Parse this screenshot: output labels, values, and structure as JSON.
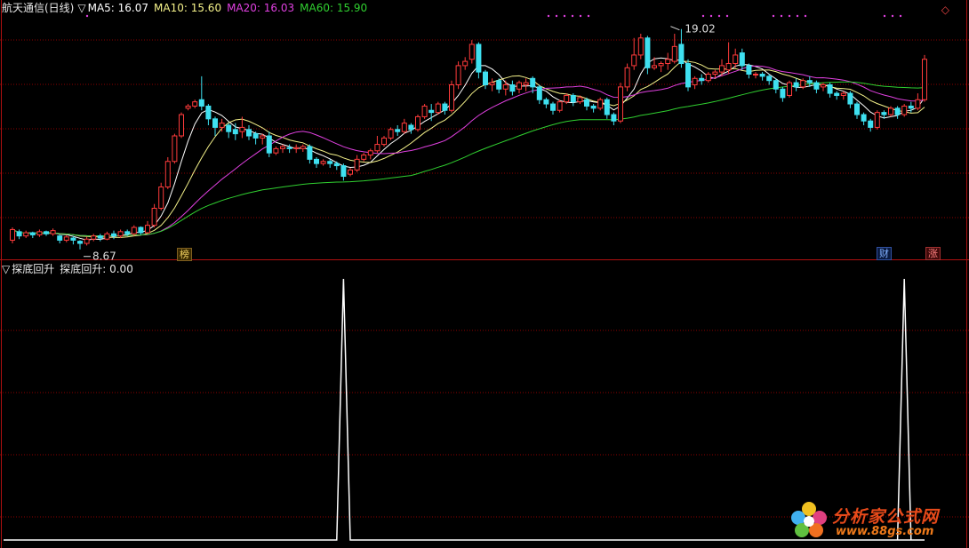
{
  "header": {
    "stock_name": "航天通信(日线)",
    "toggle": "▽",
    "ma5": "MA5: 16.07",
    "ma10": "MA10: 15.60",
    "ma20": "MA20: 16.03",
    "ma60": "MA60: 15.90"
  },
  "sub_header": {
    "toggle": "▽",
    "indicator": "探底回升",
    "value": "探底回升: 0.00"
  },
  "price_annotations": {
    "high": "19.02",
    "low": "8.67"
  },
  "badges": {
    "bang": "榜",
    "cai": "财",
    "zhang": "涨"
  },
  "logo": {
    "name": "分析家公式网",
    "url": "www.88gs.com"
  },
  "colors": {
    "up": "#ff3b3b",
    "down": "#3fe0f0",
    "ma5": "#ffffff",
    "ma10": "#f5f28a",
    "ma20": "#e040e0",
    "ma60": "#30d030",
    "grid": "#8b0000",
    "indicator": "#ffffff"
  },
  "chart_data": [
    {
      "type": "candlestick",
      "title": "航天通信(日线)",
      "ylim": [
        8.2,
        19.8
      ],
      "candles": [
        [
          9.1,
          9.6,
          8.95,
          9.7
        ],
        [
          9.5,
          9.3,
          9.15,
          9.6
        ],
        [
          9.3,
          9.45,
          9.2,
          9.55
        ],
        [
          9.45,
          9.35,
          9.2,
          9.5
        ],
        [
          9.35,
          9.5,
          9.25,
          9.6
        ],
        [
          9.5,
          9.4,
          9.3,
          9.55
        ],
        [
          9.4,
          9.55,
          9.3,
          9.65
        ],
        [
          9.3,
          9.1,
          8.95,
          9.35
        ],
        [
          9.1,
          9.25,
          9.0,
          9.35
        ],
        [
          9.2,
          9.1,
          8.9,
          9.3
        ],
        [
          9.05,
          8.95,
          8.67,
          9.1
        ],
        [
          8.95,
          9.15,
          8.85,
          9.25
        ],
        [
          9.15,
          9.3,
          9.05,
          9.4
        ],
        [
          9.3,
          9.2,
          9.05,
          9.4
        ],
        [
          9.15,
          9.4,
          9.1,
          9.5
        ],
        [
          9.4,
          9.3,
          9.15,
          9.55
        ],
        [
          9.3,
          9.5,
          9.2,
          9.6
        ],
        [
          9.5,
          9.4,
          9.3,
          9.6
        ],
        [
          9.4,
          9.7,
          9.3,
          9.8
        ],
        [
          9.7,
          9.45,
          9.35,
          9.75
        ],
        [
          9.45,
          9.8,
          9.4,
          10.0
        ],
        [
          9.8,
          10.6,
          9.7,
          10.8
        ],
        [
          10.6,
          11.6,
          10.5,
          11.8
        ],
        [
          11.6,
          12.8,
          11.5,
          13.0
        ],
        [
          12.8,
          14.0,
          12.7,
          14.1
        ],
        [
          14.0,
          15.0,
          13.9,
          15.1
        ],
        [
          15.3,
          15.4,
          15.2,
          15.5
        ],
        [
          15.4,
          15.6,
          15.3,
          15.7
        ],
        [
          15.7,
          15.4,
          15.2,
          16.8
        ],
        [
          15.4,
          14.8,
          14.5,
          15.5
        ],
        [
          14.8,
          14.4,
          14.0,
          14.9
        ],
        [
          14.4,
          14.6,
          14.2,
          14.8
        ],
        [
          14.5,
          14.2,
          13.9,
          14.6
        ],
        [
          14.3,
          14.1,
          13.8,
          14.6
        ],
        [
          14.2,
          14.4,
          13.9,
          14.9
        ],
        [
          14.3,
          14.0,
          13.8,
          14.5
        ],
        [
          14.1,
          13.9,
          13.6,
          14.2
        ],
        [
          13.9,
          14.0,
          13.6,
          14.1
        ],
        [
          14.0,
          13.2,
          13.0,
          14.2
        ],
        [
          13.2,
          13.4,
          13.1,
          13.5
        ],
        [
          13.4,
          13.5,
          13.2,
          13.6
        ],
        [
          13.45,
          13.4,
          13.2,
          13.6
        ],
        [
          13.4,
          13.45,
          13.2,
          13.6
        ],
        [
          13.4,
          13.5,
          13.25,
          13.6
        ],
        [
          13.5,
          12.9,
          12.7,
          13.6
        ],
        [
          12.9,
          12.7,
          12.5,
          13.0
        ],
        [
          12.7,
          12.8,
          12.6,
          12.9
        ],
        [
          12.8,
          12.7,
          12.5,
          12.9
        ],
        [
          12.7,
          12.6,
          12.4,
          12.8
        ],
        [
          12.6,
          12.1,
          11.9,
          12.7
        ],
        [
          12.2,
          12.4,
          12.1,
          12.5
        ],
        [
          12.4,
          12.9,
          12.3,
          13.1
        ],
        [
          12.9,
          13.1,
          12.8,
          13.2
        ],
        [
          13.1,
          13.3,
          12.9,
          13.4
        ],
        [
          13.3,
          13.6,
          13.2,
          14.0
        ],
        [
          13.6,
          13.9,
          13.5,
          14.0
        ],
        [
          13.9,
          14.3,
          13.8,
          14.4
        ],
        [
          14.3,
          14.2,
          14.0,
          14.5
        ],
        [
          14.2,
          14.6,
          14.1,
          14.8
        ],
        [
          14.5,
          14.3,
          14.1,
          14.6
        ],
        [
          14.3,
          14.9,
          14.2,
          15.0
        ],
        [
          14.9,
          15.4,
          14.8,
          15.5
        ],
        [
          15.2,
          15.1,
          14.7,
          15.5
        ],
        [
          15.1,
          15.5,
          15.0,
          15.6
        ],
        [
          15.5,
          15.2,
          15.0,
          15.6
        ],
        [
          15.2,
          16.4,
          15.1,
          16.6
        ],
        [
          16.4,
          17.3,
          16.2,
          17.5
        ],
        [
          17.3,
          17.5,
          17.1,
          17.7
        ],
        [
          17.6,
          18.3,
          17.4,
          18.5
        ],
        [
          18.3,
          17.0,
          16.7,
          18.4
        ],
        [
          17.0,
          16.4,
          16.2,
          17.1
        ],
        [
          16.4,
          16.5,
          16.1,
          16.7
        ],
        [
          16.6,
          16.2,
          16.0,
          16.7
        ],
        [
          16.2,
          16.4,
          15.9,
          16.6
        ],
        [
          16.4,
          16.1,
          15.9,
          16.6
        ],
        [
          16.2,
          16.5,
          16.0,
          16.6
        ],
        [
          16.4,
          16.5,
          16.1,
          16.7
        ],
        [
          16.7,
          16.3,
          16.0,
          16.8
        ],
        [
          16.3,
          15.7,
          15.5,
          16.4
        ],
        [
          15.7,
          15.5,
          15.3,
          15.8
        ],
        [
          15.5,
          15.2,
          15.0,
          15.6
        ],
        [
          15.2,
          15.6,
          15.1,
          15.7
        ],
        [
          15.6,
          15.9,
          15.5,
          16.0
        ],
        [
          15.9,
          15.6,
          15.4,
          16.0
        ],
        [
          15.6,
          15.8,
          15.5,
          15.9
        ],
        [
          15.7,
          15.4,
          15.2,
          15.8
        ],
        [
          15.4,
          15.3,
          15.1,
          15.5
        ],
        [
          15.3,
          15.7,
          15.2,
          15.8
        ],
        [
          15.7,
          15.0,
          14.8,
          15.8
        ],
        [
          15.0,
          14.7,
          14.5,
          15.1
        ],
        [
          14.7,
          16.3,
          14.6,
          16.5
        ],
        [
          16.3,
          17.2,
          16.1,
          17.4
        ],
        [
          17.3,
          17.8,
          17.1,
          18.6
        ],
        [
          17.8,
          18.6,
          17.6,
          18.8
        ],
        [
          18.6,
          17.2,
          16.9,
          18.7
        ],
        [
          17.2,
          17.3,
          17.1,
          17.7
        ],
        [
          17.3,
          17.4,
          17.0,
          17.5
        ],
        [
          17.4,
          17.6,
          17.1,
          17.9
        ],
        [
          17.5,
          18.2,
          17.4,
          18.8
        ],
        [
          18.3,
          17.4,
          17.2,
          19.02
        ],
        [
          17.4,
          16.3,
          16.1,
          17.6
        ],
        [
          16.4,
          16.7,
          16.2,
          16.8
        ],
        [
          16.7,
          16.6,
          16.4,
          16.9
        ],
        [
          16.6,
          16.9,
          16.5,
          17.0
        ],
        [
          16.9,
          17.0,
          16.7,
          17.1
        ],
        [
          17.0,
          17.3,
          16.8,
          17.6
        ],
        [
          17.1,
          17.4,
          16.9,
          18.4
        ],
        [
          17.4,
          17.8,
          17.2,
          18.1
        ],
        [
          17.9,
          17.3,
          17.1,
          18.1
        ],
        [
          17.3,
          16.9,
          16.7,
          17.4
        ],
        [
          16.9,
          16.9,
          16.7,
          17.0
        ],
        [
          16.9,
          16.8,
          16.6,
          17.0
        ],
        [
          16.8,
          16.6,
          16.4,
          16.9
        ],
        [
          16.6,
          16.2,
          16.0,
          16.7
        ],
        [
          16.2,
          15.8,
          15.6,
          16.3
        ],
        [
          15.9,
          16.5,
          15.8,
          16.6
        ],
        [
          16.5,
          16.3,
          16.1,
          16.7
        ],
        [
          16.3,
          16.6,
          16.2,
          16.7
        ],
        [
          16.6,
          16.5,
          16.3,
          16.8
        ],
        [
          16.5,
          16.2,
          16.0,
          16.6
        ],
        [
          16.3,
          16.4,
          16.1,
          16.5
        ],
        [
          16.4,
          16.0,
          15.8,
          16.5
        ],
        [
          16.0,
          15.9,
          15.7,
          16.1
        ],
        [
          15.9,
          16.0,
          15.7,
          16.1
        ],
        [
          16.0,
          15.5,
          15.3,
          16.1
        ],
        [
          15.5,
          15.0,
          14.8,
          15.6
        ],
        [
          15.0,
          14.7,
          14.5,
          15.1
        ],
        [
          14.7,
          14.4,
          14.2,
          14.8
        ],
        [
          14.4,
          15.1,
          14.3,
          15.2
        ],
        [
          15.1,
          15.0,
          14.8,
          15.2
        ],
        [
          15.0,
          15.3,
          14.9,
          15.4
        ],
        [
          15.3,
          15.0,
          14.8,
          15.4
        ],
        [
          15.0,
          15.4,
          14.9,
          15.5
        ],
        [
          15.4,
          15.3,
          15.1,
          15.6
        ],
        [
          15.3,
          15.7,
          15.2,
          16.0
        ],
        [
          15.7,
          17.6,
          15.6,
          17.8
        ]
      ],
      "ma_series": [
        "MA5",
        "MA10",
        "MA20",
        "MA60"
      ]
    },
    {
      "type": "line",
      "title": "探底回升",
      "ylim": [
        0,
        1
      ],
      "spikes_at_index": [
        49,
        132
      ],
      "values_description": "0 everywhere except 1 at spike indices"
    }
  ]
}
